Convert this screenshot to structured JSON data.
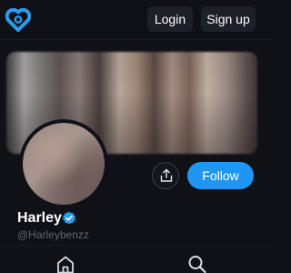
{
  "header": {
    "logo_icon": "heart-lock-logo-icon",
    "login_label": "Login",
    "signup_label": "Sign up"
  },
  "profile": {
    "display_name": "Harley",
    "handle": "@Harleybenzz",
    "verified": true,
    "verified_icon": "verified-check-icon",
    "follow_label": "Follow",
    "share_icon": "share-icon"
  },
  "bottom_nav": {
    "items": [
      "home-icon",
      "search-icon"
    ]
  },
  "colors": {
    "background": "#101117",
    "accent": "#2096f3",
    "button_dark": "#1e2029",
    "handle_text": "#5f636f"
  }
}
